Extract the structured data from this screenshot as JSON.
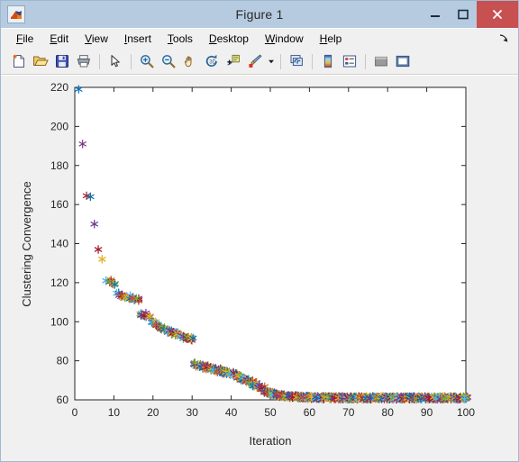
{
  "window": {
    "title": "Figure 1",
    "app_icon": "matlab-membrane-icon",
    "buttons": {
      "minimize": "minimize-icon",
      "maximize": "maximize-icon",
      "close": "close-icon"
    }
  },
  "menu": {
    "items": [
      {
        "label": "File",
        "mnemonic": "F"
      },
      {
        "label": "Edit",
        "mnemonic": "E"
      },
      {
        "label": "View",
        "mnemonic": "V"
      },
      {
        "label": "Insert",
        "mnemonic": "I"
      },
      {
        "label": "Tools",
        "mnemonic": "T"
      },
      {
        "label": "Desktop",
        "mnemonic": "D"
      },
      {
        "label": "Window",
        "mnemonic": "W"
      },
      {
        "label": "Help",
        "mnemonic": "H"
      }
    ],
    "undock_icon": "undock-arrow-icon"
  },
  "toolbar": {
    "buttons": [
      {
        "name": "new-figure-icon",
        "tip": "New Figure"
      },
      {
        "name": "open-file-icon",
        "tip": "Open File"
      },
      {
        "name": "save-figure-icon",
        "tip": "Save Figure"
      },
      {
        "name": "print-figure-icon",
        "tip": "Print Figure"
      },
      {
        "name": "separator",
        "tip": ""
      },
      {
        "name": "pointer-select-icon",
        "tip": "Edit Plot"
      },
      {
        "name": "separator",
        "tip": ""
      },
      {
        "name": "zoom-in-icon",
        "tip": "Zoom In"
      },
      {
        "name": "zoom-out-icon",
        "tip": "Zoom Out"
      },
      {
        "name": "pan-hand-icon",
        "tip": "Pan"
      },
      {
        "name": "rotate-3d-icon",
        "tip": "Rotate 3D"
      },
      {
        "name": "data-cursor-icon",
        "tip": "Data Cursor"
      },
      {
        "name": "brush-data-icon",
        "tip": "Brush/Select Data"
      },
      {
        "name": "brush-dropdown-caret-icon",
        "tip": ""
      },
      {
        "name": "separator",
        "tip": ""
      },
      {
        "name": "link-plot-icon",
        "tip": "Link Plot"
      },
      {
        "name": "separator",
        "tip": ""
      },
      {
        "name": "colorbar-icon",
        "tip": "Insert Colorbar"
      },
      {
        "name": "legend-icon",
        "tip": "Insert Legend"
      },
      {
        "name": "separator",
        "tip": ""
      },
      {
        "name": "hide-plot-tools-icon",
        "tip": "Hide Plot Tools"
      },
      {
        "name": "show-plot-tools-icon",
        "tip": "Show Plot Tools and Dock Figure"
      }
    ]
  },
  "chart_data": {
    "type": "scatter",
    "title": "",
    "xlabel": "Iteration",
    "ylabel": "Clustering Convergence",
    "xlim": [
      0,
      100
    ],
    "ylim": [
      60,
      220
    ],
    "xticks": [
      0,
      10,
      20,
      30,
      40,
      50,
      60,
      70,
      80,
      90,
      100
    ],
    "yticks": [
      60,
      80,
      100,
      120,
      140,
      160,
      180,
      200,
      220
    ],
    "grid": false,
    "legend": null,
    "marker": "asterisk",
    "marker_size": 6,
    "color_order": [
      "#0072BD",
      "#D95319",
      "#EDB120",
      "#7E2F8E",
      "#77AC30",
      "#4DBEEE",
      "#A2142F",
      "#0072BD",
      "#D95319",
      "#EDB120",
      "#7E2F8E",
      "#77AC30",
      "#4DBEEE",
      "#A2142F"
    ],
    "x": [
      1,
      2,
      3,
      4,
      5,
      6,
      7,
      8,
      9,
      10,
      11,
      12,
      13,
      14,
      15,
      16,
      17,
      18,
      19,
      20,
      21,
      22,
      23,
      24,
      25,
      26,
      27,
      28,
      29,
      30,
      31,
      32,
      33,
      34,
      35,
      36,
      37,
      38,
      39,
      40,
      41,
      42,
      43,
      44,
      45,
      46,
      47,
      48,
      49,
      50,
      51,
      52,
      53,
      54,
      55,
      56,
      57,
      58,
      59,
      60,
      61,
      62,
      63,
      64,
      65,
      66,
      67,
      68,
      69,
      70,
      71,
      72,
      73,
      74,
      75,
      76,
      77,
      78,
      79,
      80,
      81,
      82,
      83,
      84,
      85,
      86,
      87,
      88,
      89,
      90,
      91,
      92,
      93,
      94,
      95,
      96,
      97,
      98,
      99,
      100
    ],
    "y": [
      219,
      191,
      164.5,
      164,
      150,
      137,
      132,
      121,
      120.5,
      120,
      114,
      113.5,
      113,
      112.5,
      112,
      111.5,
      104,
      103.5,
      103,
      100,
      99,
      97,
      96,
      95,
      94.5,
      94,
      93,
      92,
      91.5,
      91,
      78,
      77.5,
      77,
      76.5,
      76,
      75.5,
      75,
      74.5,
      74,
      73.5,
      73,
      72,
      71,
      70,
      69,
      68,
      67,
      66,
      64,
      63.5,
      63,
      62.5,
      62.2,
      62,
      61.8,
      61.7,
      61.6,
      61.5,
      61.4,
      61.3,
      61.2,
      61.15,
      61.1,
      61.1,
      61.05,
      61.05,
      61,
      61,
      61,
      61,
      61,
      61,
      61,
      61,
      61,
      61,
      61,
      61,
      61,
      61,
      61,
      61,
      61,
      61,
      61,
      61,
      61,
      61,
      61,
      61,
      61,
      61,
      61,
      61,
      61,
      61,
      61,
      61,
      61,
      61
    ],
    "series_count": 14,
    "description": "Clustering convergence curve: cost decreases monotonically from about 219 at iteration 1 to a plateau of about 61 from iteration 60 onward. Overlapping asterisk markers from multiple runs share nearly identical values at each iteration."
  }
}
